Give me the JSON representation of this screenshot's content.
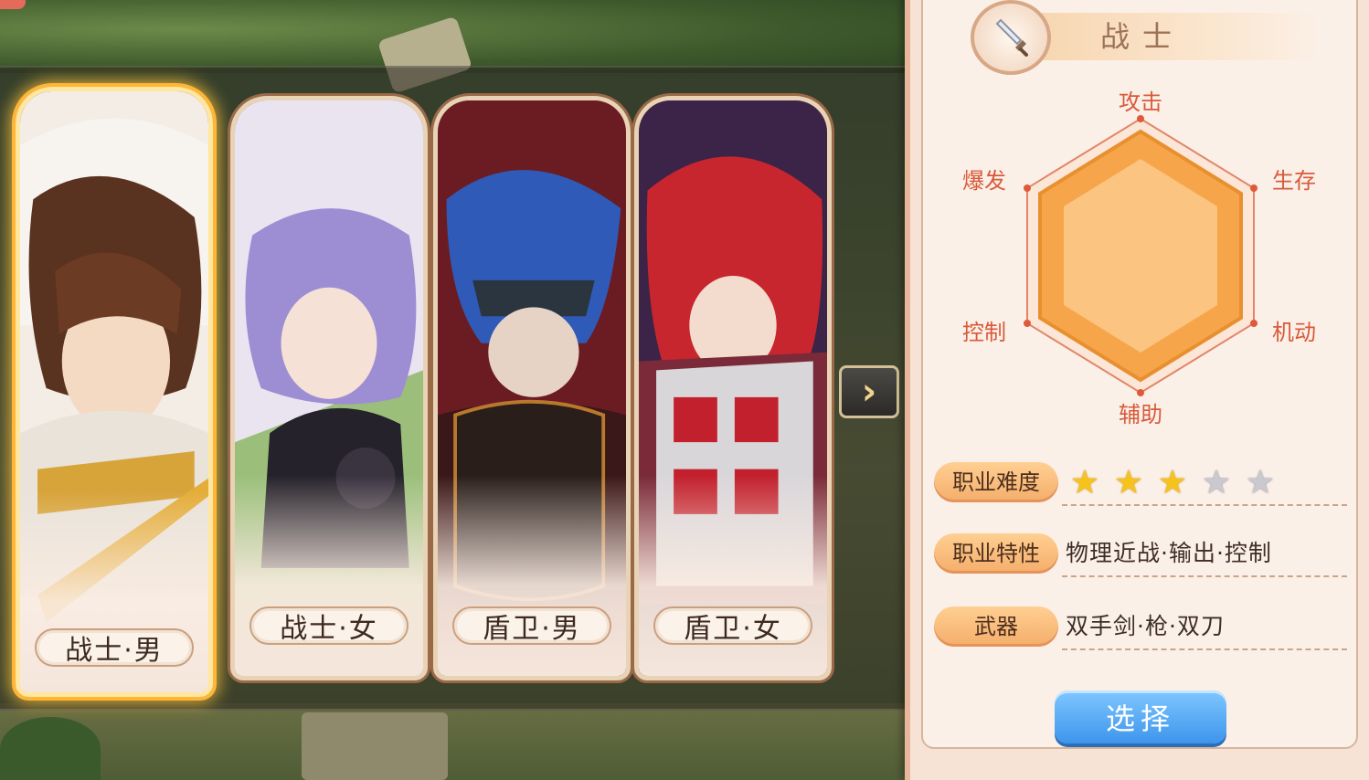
{
  "cards": [
    {
      "label": "战士·男",
      "selected": true
    },
    {
      "label": "战士·女",
      "selected": false
    },
    {
      "label": "盾卫·男",
      "selected": false
    },
    {
      "label": "盾卫·女",
      "selected": false
    }
  ],
  "next_arrow": {
    "icon": "chevron-right-icon",
    "glyph": "›"
  },
  "panel": {
    "class_name": "战士",
    "emblem_icon": "sword-icon",
    "radar": {
      "labels": {
        "top": "攻击",
        "top_right": "生存",
        "bottom_right": "机动",
        "bottom": "辅助",
        "bottom_left": "控制",
        "top_left": "爆发"
      },
      "fill_color": "#f7a54a"
    },
    "difficulty": {
      "label": "职业难度",
      "stars_filled": 3,
      "stars_total": 5
    },
    "traits": {
      "label": "职业特性",
      "value": "物理近战·输出·控制"
    },
    "weapons": {
      "label": "武器",
      "value": "双手剑·枪·双刀"
    },
    "select_label": "选择"
  },
  "colors": {
    "accent": "#f4ad6a",
    "selected_glow": "#ffb637",
    "button": "#3d95ec",
    "star_on": "#f6c21c",
    "star_off": "#c9c9cf"
  }
}
